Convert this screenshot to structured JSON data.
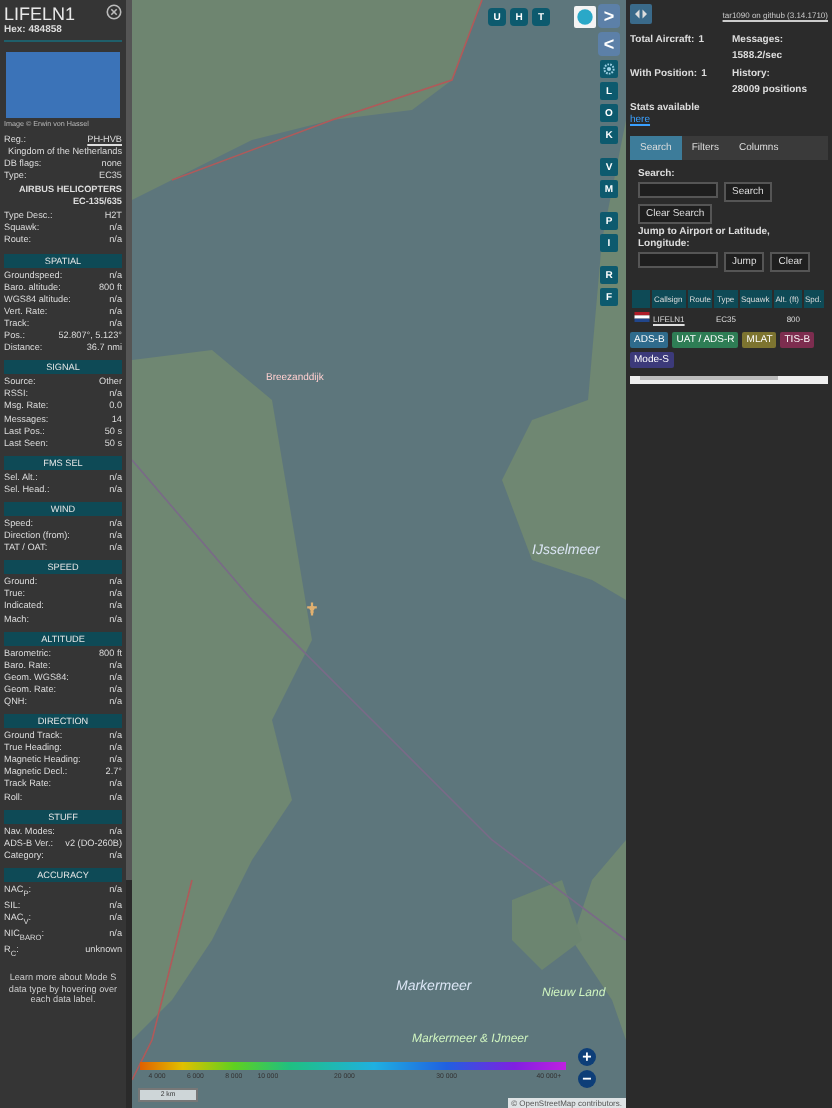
{
  "detail_panel": {
    "callsign": "LIFELN1",
    "hex_label": "Hex:",
    "hex": "484858",
    "photo_credit": "Image © Erwin von Hassel",
    "rows": [
      {
        "kind": "link",
        "label": "Reg.:",
        "value": "PH-HVB"
      },
      {
        "kind": "note",
        "value": "Kingdom of the Netherlands"
      },
      {
        "kind": "pair",
        "label": "DB flags:",
        "value": "none"
      },
      {
        "kind": "pair",
        "label": "Type:",
        "value": "EC35"
      },
      {
        "kind": "heading",
        "value": "AIRBUS HELICOPTERS EC-135/635"
      },
      {
        "kind": "pair",
        "label": "Type Desc.:",
        "value": "H2T"
      },
      {
        "kind": "pair",
        "label": "Squawk:",
        "value": "n/a"
      },
      {
        "kind": "pair",
        "label": "Route:",
        "value": "n/a"
      }
    ],
    "sections": [
      {
        "title": "SPATIAL",
        "rows": [
          {
            "label": "Groundspeed:",
            "value": "n/a"
          },
          {
            "label": "Baro. altitude:",
            "value": "800 ft"
          },
          {
            "label": "WGS84 altitude:",
            "value": "n/a"
          },
          {
            "label": "Vert. Rate:",
            "value": "n/a"
          },
          {
            "label": "Track:",
            "value": "n/a"
          },
          {
            "label": "Pos.:",
            "value": "52.807°, 5.123°"
          },
          {
            "label": "Distance:",
            "value": "36.7 nmi"
          }
        ]
      },
      {
        "title": "SIGNAL",
        "rows": [
          {
            "label": "Source:",
            "value": "Other"
          },
          {
            "label": "RSSI:",
            "value": "n/a"
          },
          {
            "label": "Msg. Rate:",
            "value": "0.0"
          },
          {
            "label": "Messages:",
            "value": "14"
          },
          {
            "label": "Last Pos.:",
            "value": "50 s"
          },
          {
            "label": "Last Seen:",
            "value": "50 s"
          }
        ]
      },
      {
        "title": "FMS SEL",
        "rows": [
          {
            "label": "Sel. Alt.:",
            "value": "n/a"
          },
          {
            "label": "Sel. Head.:",
            "value": "n/a"
          }
        ]
      },
      {
        "title": "WIND",
        "rows": [
          {
            "label": "Speed:",
            "value": "n/a"
          },
          {
            "label": "Direction (from):",
            "value": "n/a"
          },
          {
            "label": "TAT / OAT:",
            "value": "n/a"
          }
        ]
      },
      {
        "title": "SPEED",
        "rows": [
          {
            "label": "Ground:",
            "value": "n/a"
          },
          {
            "label": "True:",
            "value": "n/a"
          },
          {
            "label": "Indicated:",
            "value": "n/a"
          },
          {
            "label": "Mach:",
            "value": "n/a"
          }
        ]
      },
      {
        "title": "ALTITUDE",
        "rows": [
          {
            "label": "Barometric:",
            "value": "800 ft"
          },
          {
            "label": "Baro. Rate:",
            "value": "n/a"
          },
          {
            "label": "Geom. WGS84:",
            "value": "n/a"
          },
          {
            "label": "Geom. Rate:",
            "value": "n/a"
          },
          {
            "label": "QNH:",
            "value": "n/a"
          }
        ]
      },
      {
        "title": "DIRECTION",
        "rows": [
          {
            "label": "Ground Track:",
            "value": "n/a"
          },
          {
            "label": "True Heading:",
            "value": "n/a"
          },
          {
            "label": "Magnetic Heading:",
            "value": "n/a"
          },
          {
            "label": "Magnetic Decl.:",
            "value": "2.7°"
          },
          {
            "label": "Track Rate:",
            "value": "n/a"
          },
          {
            "label": "Roll:",
            "value": "n/a"
          }
        ]
      },
      {
        "title": "STUFF",
        "rows": [
          {
            "label": "Nav. Modes:",
            "value": "n/a"
          },
          {
            "label": "ADS-B Ver.:",
            "value": "v2 (DO-260B)"
          },
          {
            "label": "Category:",
            "value": "n/a"
          }
        ]
      },
      {
        "title": "ACCURACY",
        "rows": [
          {
            "label": "NAC$_{P}$:",
            "value": "n/a"
          },
          {
            "label": "SIL:",
            "value": "n/a"
          },
          {
            "label": "NAC$_{V}$:",
            "value": "n/a"
          },
          {
            "label": "NIC$_{BARO}$:",
            "value": "n/a"
          },
          {
            "label": "R$_{C}$:",
            "value": "unknown"
          }
        ]
      }
    ],
    "footer": "Learn more about Mode S data type by hovering over each data label."
  },
  "map": {
    "top_buttons": [
      "U",
      "H",
      "T"
    ],
    "side_buttons": [
      {
        "kind": "arrow",
        "label": ">"
      },
      {
        "kind": "arrow",
        "label": "<"
      },
      {
        "kind": "gear"
      },
      {
        "kind": "letter",
        "label": "L"
      },
      {
        "kind": "letter",
        "label": "O"
      },
      {
        "kind": "letter",
        "label": "K"
      },
      {
        "kind": "gap"
      },
      {
        "kind": "letter",
        "label": "V"
      },
      {
        "kind": "letter",
        "label": "M"
      },
      {
        "kind": "gap"
      },
      {
        "kind": "letter",
        "label": "P"
      },
      {
        "kind": "letter",
        "label": "I"
      },
      {
        "kind": "gap"
      },
      {
        "kind": "letter",
        "label": "R"
      },
      {
        "kind": "letter",
        "label": "F"
      }
    ],
    "labels": [
      {
        "text": "Breezanddijk",
        "kind": "place"
      },
      {
        "text": "IJsselmeer",
        "kind": "water"
      },
      {
        "text": "Markermeer",
        "kind": "water"
      },
      {
        "text": "Nieuw Land",
        "kind": "nature"
      },
      {
        "text": "Markermeer & IJmeer",
        "kind": "nature"
      }
    ],
    "altitude_ticks": [
      "4 000",
      "6 000",
      "8 000",
      "10 000",
      "20 000",
      "30 000",
      "40 000+"
    ],
    "scale": "2 km",
    "attribution": "© OpenStreetMap contributors.",
    "zoom_in": "+",
    "zoom_out": "−"
  },
  "side_panel": {
    "version_link": "tar1090 on github (3.14.1710)",
    "stats": [
      {
        "label": "Total Aircraft:",
        "value": "1"
      },
      {
        "label": "Messages:",
        "value": "1588.2/sec"
      },
      {
        "label": "With Position:",
        "value": "1"
      },
      {
        "label": "History:",
        "value": "28009 positions"
      }
    ],
    "stats_note": "Stats available",
    "stats_link": "here",
    "tabs": [
      {
        "label": "Search",
        "selected": true
      },
      {
        "label": "Filters",
        "selected": false
      },
      {
        "label": "Columns",
        "selected": false
      }
    ],
    "search_label": "Search:",
    "search_button": "Search",
    "clear_search_button": "Clear Search",
    "jump_label": "Jump to Airport or Latitude, Longitude:",
    "jump_button": "Jump",
    "clear_button": "Clear",
    "table": {
      "columns": [
        "Callsign",
        "Route",
        "Type",
        "Squawk",
        "Alt. (ft)",
        "Spd."
      ],
      "rows": [
        {
          "callsign": "LIFELN1",
          "route": "",
          "type": "EC35",
          "squawk": "",
          "altitude": "800",
          "speed": ""
        }
      ]
    },
    "legend": [
      {
        "label": "ADS-B",
        "color": "#2f6b8c"
      },
      {
        "label": "UAT / ADS-R",
        "color": "#2e7d55"
      },
      {
        "label": "MLAT",
        "color": "#7d7430"
      },
      {
        "label": "TIS-B",
        "color": "#7d2d4f"
      },
      {
        "label": "Mode-S",
        "color": "#3c3a7a"
      }
    ]
  }
}
